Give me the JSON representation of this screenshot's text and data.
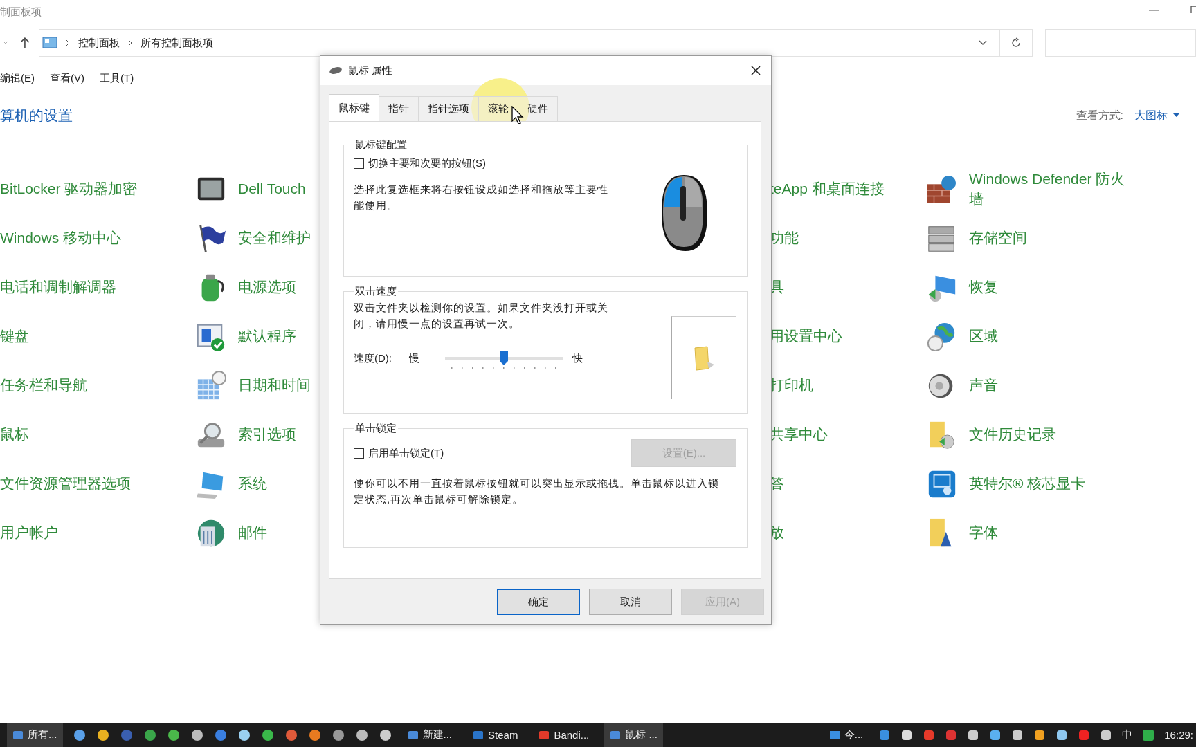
{
  "window": {
    "title": "制面板项"
  },
  "address_bar": {
    "path": [
      "控制面板",
      "所有控制面板项"
    ]
  },
  "menu": [
    "编辑(E)",
    "查看(V)",
    "工具(T)"
  ],
  "heading": "算机的设置",
  "view_by": {
    "label": "查看方式:",
    "value": "大图标"
  },
  "rows": [
    [
      "BitLocker 驱动器加密",
      "Dell Touch",
      "teApp 和桌面连接",
      "Windows Defender 防火墙"
    ],
    [
      "Windows 移动中心",
      "安全和维护",
      "功能",
      "存储空间"
    ],
    [
      "电话和调制解调器",
      "电源选项",
      "具",
      "恢复"
    ],
    [
      "键盘",
      "默认程序",
      "用设置中心",
      "区域"
    ],
    [
      "任务栏和导航",
      "日期和时间",
      "打印机",
      "声音"
    ],
    [
      "鼠标",
      "索引选项",
      "共享中心",
      "文件历史记录"
    ],
    [
      "文件资源管理器选项",
      "系统",
      "答",
      "英特尔® 核芯显卡"
    ],
    [
      "用户帐户",
      "邮件",
      "放",
      "字体"
    ]
  ],
  "dialog": {
    "title": "鼠标 属性",
    "tabs": [
      {
        "label": "鼠标键",
        "selected": true
      },
      {
        "label": "指针",
        "selected": false
      },
      {
        "label": "指针选项",
        "selected": false
      },
      {
        "label": "滚轮",
        "selected": false
      },
      {
        "label": "硬件",
        "selected": false
      }
    ],
    "button_config": {
      "title": "鼠标键配置",
      "checkbox": {
        "label": "切换主要和次要的按钮(S)",
        "checked": false
      },
      "description": "选择此复选框来将右按钮设成如选择和拖放等主要性能使用。"
    },
    "double_click": {
      "title": "双击速度",
      "description": "双击文件夹以检测你的设置。如果文件夹没打开或关闭，请用慢一点的设置再试一次。",
      "speed_label": "速度(D):",
      "slow": "慢",
      "fast": "快",
      "level": 0.5
    },
    "click_lock": {
      "title": "单击锁定",
      "checkbox": {
        "label": "启用单击锁定(T)",
        "checked": false
      },
      "settings_button": {
        "label": "设置(E)...",
        "disabled": true
      },
      "description": "使你可以不用一直按着鼠标按钮就可以突出显示或拖拽。单击鼠标以进入锁定状态,再次单击鼠标可解除锁定。"
    },
    "buttons": [
      {
        "label": "确定",
        "default": true,
        "disabled": false
      },
      {
        "label": "取消",
        "default": false,
        "disabled": false
      },
      {
        "label": "应用(A)",
        "default": false,
        "disabled": true
      }
    ]
  },
  "taskbar": {
    "apps": [
      {
        "label": "所有...",
        "active": true
      },
      {
        "label": "新建...",
        "active": false
      },
      {
        "label": "Steam",
        "active": false
      },
      {
        "label": "Bandi...",
        "active": false
      },
      {
        "label": "鼠标 ...",
        "active": true
      }
    ],
    "tray": {
      "label": "今...",
      "ime": "中",
      "clock": "16:29:"
    }
  }
}
